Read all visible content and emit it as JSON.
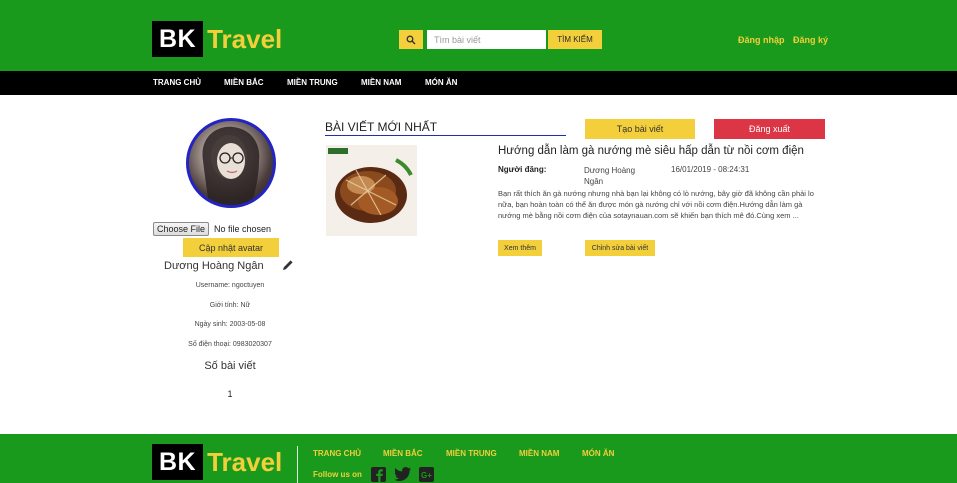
{
  "brand": {
    "bk": "BK",
    "travel": "Travel"
  },
  "search": {
    "placeholder": "Tìm bài viết",
    "submit_label": "TÌM KIẾM",
    "icon": "search-icon"
  },
  "auth": {
    "login": "Đăng nhập",
    "register": "Đăng ký"
  },
  "nav": {
    "items": [
      "TRANG CHỦ",
      "MIỀN BẮC",
      "MIỀN TRUNG",
      "MIỀN NAM",
      "MÓN ĂN"
    ]
  },
  "profile": {
    "file_button": "Choose File",
    "file_status": "No file chosen",
    "update_avatar": "Cập nhật avatar",
    "fullname": "Dương Hoàng Ngân",
    "edit_icon": "pencil-icon",
    "username": "Username: ngoctuyen",
    "gender": "Giới tính: Nữ",
    "birthday": "Ngày sinh: 2003-05-08",
    "phone": "Số điện thoại: 0983020307",
    "post_count_label": "Số bài viết",
    "post_count": "1"
  },
  "main": {
    "section_title": "BÀI VIẾT MỚI NHẤT",
    "create_post": "Tạo bài viết",
    "logout": "Đăng xuất",
    "post": {
      "title": "Hướng dẫn làm gà nướng mè siêu hấp dẫn từ nồi cơm điện",
      "author_label": "Người đăng:",
      "author": "Dương Hoàng Ngân",
      "time": "16/01/2019 - 08:24:31",
      "excerpt": "Bạn rất thích ăn gà nướng nhưng nhà bạn lại không có lò nướng, bây giờ đã không cần phải lo nữa, bạn hoàn toàn có thể ăn được món gà nướng chỉ với nồi cơm điện.Hướng dẫn làm gà nướng mè bằng nồi cơm điện của sotaynauan.com sẽ khiến bạn thích mê đó.Cùng xem ...",
      "more": "Xem thêm",
      "edit": "Chỉnh sửa bài viết"
    }
  },
  "footer": {
    "nav": [
      "TRANG CHỦ",
      "MIỀN BẮC",
      "MIỀN TRUNG",
      "MIỀN NAM",
      "MÓN ĂN"
    ],
    "follow": "Follow us on",
    "social_icons": [
      "facebook-icon",
      "twitter-icon",
      "google-plus-icon"
    ]
  },
  "colors": {
    "green": "#1a9a1c",
    "yellow": "#f2cf3b",
    "red": "#dc3545",
    "black": "#000000"
  }
}
